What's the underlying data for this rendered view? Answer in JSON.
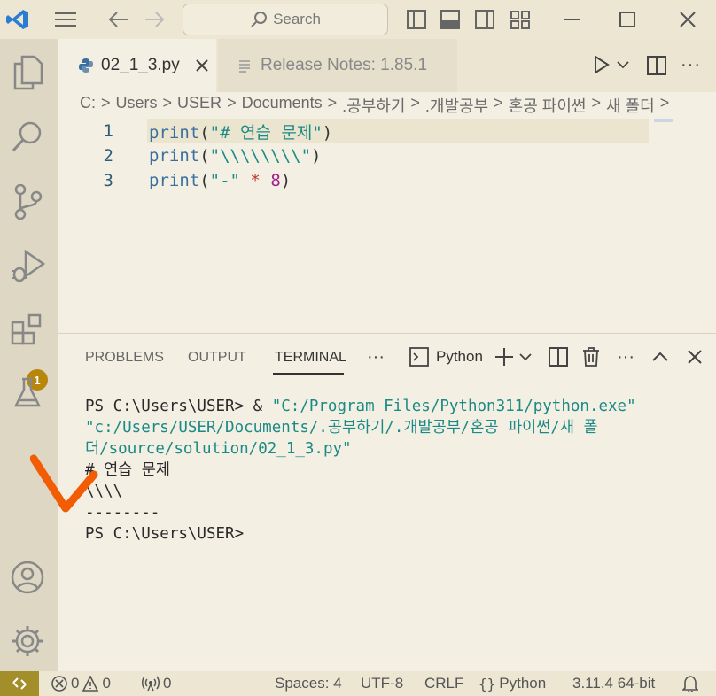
{
  "titlebar": {
    "search_placeholder": "Search"
  },
  "activity": {
    "extensions_badge": "1"
  },
  "tabs": [
    {
      "label": "02_1_3.py",
      "active": true
    },
    {
      "label": "Release Notes: 1.85.1",
      "active": false
    }
  ],
  "breadcrumb": [
    "C:",
    ">",
    "Users",
    ">",
    "USER",
    ">",
    "Documents",
    ">",
    ".공부하기",
    ">",
    ".개발공부",
    ">",
    "혼공 파이썬",
    ">",
    "새 폴더",
    ">"
  ],
  "editor": {
    "lines": [
      {
        "num": "1",
        "fn": "print",
        "p1": "(",
        "str": "\"# 연습 문제\"",
        "op": "",
        "n": "",
        "p2": ")"
      },
      {
        "num": "2",
        "fn": "print",
        "p1": "(",
        "str": "\"\\\\\\\\\\\\\\\\\"",
        "op": "",
        "n": "",
        "p2": ")"
      },
      {
        "num": "3",
        "fn": "print",
        "p1": "(",
        "str": "\"-\"",
        "op": " * ",
        "n": "8",
        "p2": ")"
      }
    ]
  },
  "panel": {
    "tabs": [
      "PROBLEMS",
      "OUTPUT",
      "TERMINAL"
    ],
    "more": "···",
    "terminal_name": "Python",
    "terminal": {
      "cmd_prefix": "PS C:\\Users\\USER> & ",
      "cmd_exe": "\"C:/Program Files/Python311/python.exe\"",
      "cmd_arg": " \"c:/Users/USER/Documents/.공부하기/.개발공부/혼공 파이썬/새 폴더/source/solution/02_1_3.py\"",
      "out1": "# 연습 문제",
      "out2": "\\\\\\\\",
      "out3": "--------",
      "prompt": "PS C:\\Users\\USER>"
    }
  },
  "status": {
    "errors": "0",
    "warnings": "0",
    "ports": "0",
    "spaces": "Spaces: 4",
    "encoding": "UTF-8",
    "eol": "CRLF",
    "language": "Python",
    "interpreter": "3.11.4 64-bit"
  },
  "colors": {
    "badge": "#b8860b",
    "remote": "#a28f2a",
    "vscode_blue": "#2b7cd3",
    "check_orange": "#f25c05"
  }
}
